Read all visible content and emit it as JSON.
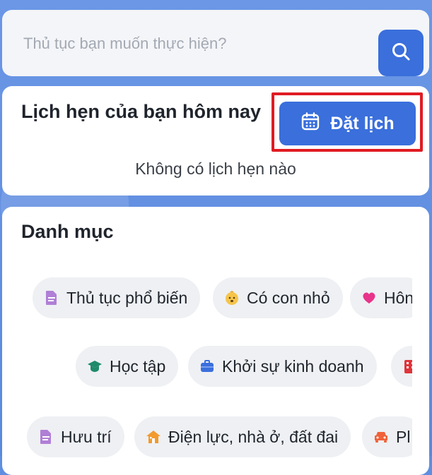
{
  "search": {
    "placeholder": "Thủ tục bạn muốn thực hiện?"
  },
  "appointments": {
    "title": "Lịch hẹn của bạn hôm nay",
    "book_label": "Đặt lịch",
    "empty_text": "Không có lịch hẹn nào"
  },
  "categories": {
    "title": "Danh mục",
    "rows": [
      [
        {
          "label": "Thủ tục phổ biến",
          "icon": "document-icon",
          "color": "#b07fd6"
        },
        {
          "label": "Có con nhỏ",
          "icon": "baby-face-icon",
          "color": "#f5c54a"
        },
        {
          "label": "Hôn",
          "icon": "heart-icon",
          "color": "#e8348a"
        }
      ],
      [
        {
          "label": "Học tập",
          "icon": "graduation-cap-icon",
          "color": "#1f8a6a"
        },
        {
          "label": "Khởi sự kinh doanh",
          "icon": "briefcase-icon",
          "color": "#3a6fdc"
        },
        {
          "label": "",
          "icon": "building-icon",
          "color": "#e0343a"
        }
      ],
      [
        {
          "label": "Hưu trí",
          "icon": "document-icon",
          "color": "#b07fd6"
        },
        {
          "label": "Điện lực, nhà ở, đất đai",
          "icon": "house-icon",
          "color": "#f29a2e"
        },
        {
          "label": "Pl",
          "icon": "car-icon",
          "color": "#f0623a"
        }
      ]
    ]
  }
}
